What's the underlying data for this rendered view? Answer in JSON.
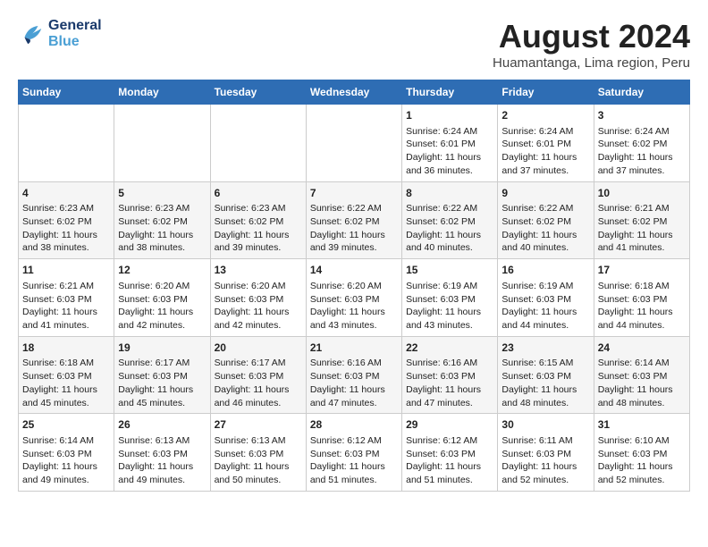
{
  "header": {
    "logo_line1": "General",
    "logo_line2": "Blue",
    "main_title": "August 2024",
    "subtitle": "Huamantanga, Lima region, Peru"
  },
  "calendar": {
    "days_of_week": [
      "Sunday",
      "Monday",
      "Tuesday",
      "Wednesday",
      "Thursday",
      "Friday",
      "Saturday"
    ],
    "weeks": [
      [
        {
          "day": "",
          "sunrise": "",
          "sunset": "",
          "daylight": ""
        },
        {
          "day": "",
          "sunrise": "",
          "sunset": "",
          "daylight": ""
        },
        {
          "day": "",
          "sunrise": "",
          "sunset": "",
          "daylight": ""
        },
        {
          "day": "",
          "sunrise": "",
          "sunset": "",
          "daylight": ""
        },
        {
          "day": "1",
          "sunrise": "Sunrise: 6:24 AM",
          "sunset": "Sunset: 6:01 PM",
          "daylight": "Daylight: 11 hours and 36 minutes."
        },
        {
          "day": "2",
          "sunrise": "Sunrise: 6:24 AM",
          "sunset": "Sunset: 6:01 PM",
          "daylight": "Daylight: 11 hours and 37 minutes."
        },
        {
          "day": "3",
          "sunrise": "Sunrise: 6:24 AM",
          "sunset": "Sunset: 6:02 PM",
          "daylight": "Daylight: 11 hours and 37 minutes."
        }
      ],
      [
        {
          "day": "4",
          "sunrise": "Sunrise: 6:23 AM",
          "sunset": "Sunset: 6:02 PM",
          "daylight": "Daylight: 11 hours and 38 minutes."
        },
        {
          "day": "5",
          "sunrise": "Sunrise: 6:23 AM",
          "sunset": "Sunset: 6:02 PM",
          "daylight": "Daylight: 11 hours and 38 minutes."
        },
        {
          "day": "6",
          "sunrise": "Sunrise: 6:23 AM",
          "sunset": "Sunset: 6:02 PM",
          "daylight": "Daylight: 11 hours and 39 minutes."
        },
        {
          "day": "7",
          "sunrise": "Sunrise: 6:22 AM",
          "sunset": "Sunset: 6:02 PM",
          "daylight": "Daylight: 11 hours and 39 minutes."
        },
        {
          "day": "8",
          "sunrise": "Sunrise: 6:22 AM",
          "sunset": "Sunset: 6:02 PM",
          "daylight": "Daylight: 11 hours and 40 minutes."
        },
        {
          "day": "9",
          "sunrise": "Sunrise: 6:22 AM",
          "sunset": "Sunset: 6:02 PM",
          "daylight": "Daylight: 11 hours and 40 minutes."
        },
        {
          "day": "10",
          "sunrise": "Sunrise: 6:21 AM",
          "sunset": "Sunset: 6:02 PM",
          "daylight": "Daylight: 11 hours and 41 minutes."
        }
      ],
      [
        {
          "day": "11",
          "sunrise": "Sunrise: 6:21 AM",
          "sunset": "Sunset: 6:03 PM",
          "daylight": "Daylight: 11 hours and 41 minutes."
        },
        {
          "day": "12",
          "sunrise": "Sunrise: 6:20 AM",
          "sunset": "Sunset: 6:03 PM",
          "daylight": "Daylight: 11 hours and 42 minutes."
        },
        {
          "day": "13",
          "sunrise": "Sunrise: 6:20 AM",
          "sunset": "Sunset: 6:03 PM",
          "daylight": "Daylight: 11 hours and 42 minutes."
        },
        {
          "day": "14",
          "sunrise": "Sunrise: 6:20 AM",
          "sunset": "Sunset: 6:03 PM",
          "daylight": "Daylight: 11 hours and 43 minutes."
        },
        {
          "day": "15",
          "sunrise": "Sunrise: 6:19 AM",
          "sunset": "Sunset: 6:03 PM",
          "daylight": "Daylight: 11 hours and 43 minutes."
        },
        {
          "day": "16",
          "sunrise": "Sunrise: 6:19 AM",
          "sunset": "Sunset: 6:03 PM",
          "daylight": "Daylight: 11 hours and 44 minutes."
        },
        {
          "day": "17",
          "sunrise": "Sunrise: 6:18 AM",
          "sunset": "Sunset: 6:03 PM",
          "daylight": "Daylight: 11 hours and 44 minutes."
        }
      ],
      [
        {
          "day": "18",
          "sunrise": "Sunrise: 6:18 AM",
          "sunset": "Sunset: 6:03 PM",
          "daylight": "Daylight: 11 hours and 45 minutes."
        },
        {
          "day": "19",
          "sunrise": "Sunrise: 6:17 AM",
          "sunset": "Sunset: 6:03 PM",
          "daylight": "Daylight: 11 hours and 45 minutes."
        },
        {
          "day": "20",
          "sunrise": "Sunrise: 6:17 AM",
          "sunset": "Sunset: 6:03 PM",
          "daylight": "Daylight: 11 hours and 46 minutes."
        },
        {
          "day": "21",
          "sunrise": "Sunrise: 6:16 AM",
          "sunset": "Sunset: 6:03 PM",
          "daylight": "Daylight: 11 hours and 47 minutes."
        },
        {
          "day": "22",
          "sunrise": "Sunrise: 6:16 AM",
          "sunset": "Sunset: 6:03 PM",
          "daylight": "Daylight: 11 hours and 47 minutes."
        },
        {
          "day": "23",
          "sunrise": "Sunrise: 6:15 AM",
          "sunset": "Sunset: 6:03 PM",
          "daylight": "Daylight: 11 hours and 48 minutes."
        },
        {
          "day": "24",
          "sunrise": "Sunrise: 6:14 AM",
          "sunset": "Sunset: 6:03 PM",
          "daylight": "Daylight: 11 hours and 48 minutes."
        }
      ],
      [
        {
          "day": "25",
          "sunrise": "Sunrise: 6:14 AM",
          "sunset": "Sunset: 6:03 PM",
          "daylight": "Daylight: 11 hours and 49 minutes."
        },
        {
          "day": "26",
          "sunrise": "Sunrise: 6:13 AM",
          "sunset": "Sunset: 6:03 PM",
          "daylight": "Daylight: 11 hours and 49 minutes."
        },
        {
          "day": "27",
          "sunrise": "Sunrise: 6:13 AM",
          "sunset": "Sunset: 6:03 PM",
          "daylight": "Daylight: 11 hours and 50 minutes."
        },
        {
          "day": "28",
          "sunrise": "Sunrise: 6:12 AM",
          "sunset": "Sunset: 6:03 PM",
          "daylight": "Daylight: 11 hours and 51 minutes."
        },
        {
          "day": "29",
          "sunrise": "Sunrise: 6:12 AM",
          "sunset": "Sunset: 6:03 PM",
          "daylight": "Daylight: 11 hours and 51 minutes."
        },
        {
          "day": "30",
          "sunrise": "Sunrise: 6:11 AM",
          "sunset": "Sunset: 6:03 PM",
          "daylight": "Daylight: 11 hours and 52 minutes."
        },
        {
          "day": "31",
          "sunrise": "Sunrise: 6:10 AM",
          "sunset": "Sunset: 6:03 PM",
          "daylight": "Daylight: 11 hours and 52 minutes."
        }
      ]
    ]
  }
}
